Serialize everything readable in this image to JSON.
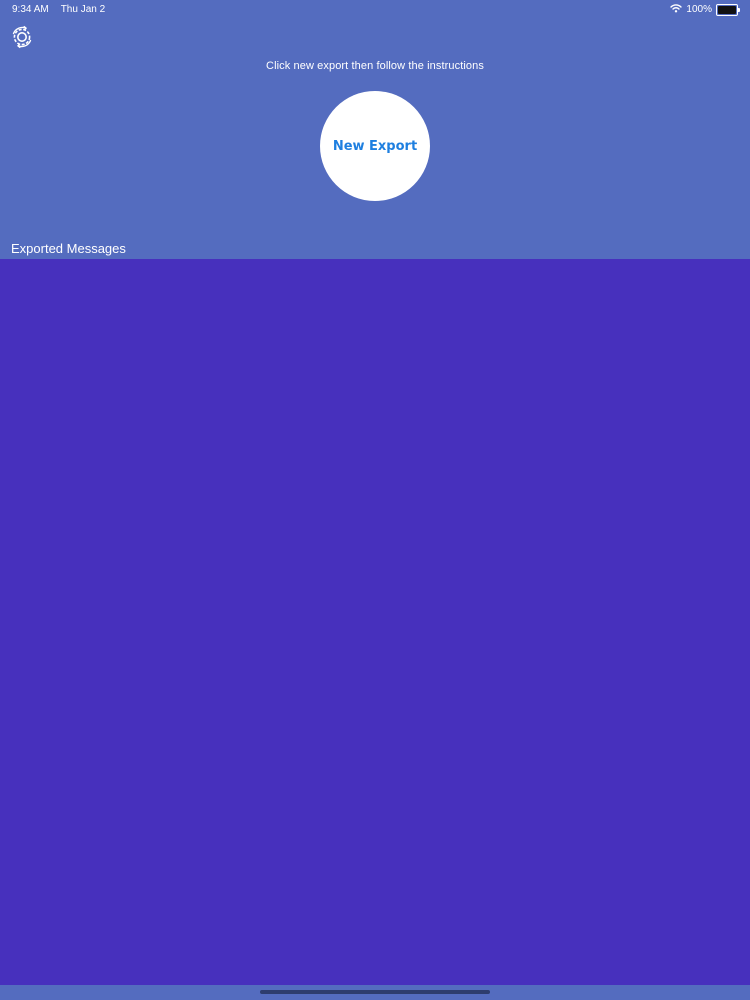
{
  "status_bar": {
    "time": "9:34 AM",
    "date": "Thu Jan 2",
    "battery_percent": "100%",
    "battery_level": 1.0,
    "wifi_icon": "wifi-icon",
    "battery_icon": "battery-icon"
  },
  "toolbar": {
    "settings_icon": "gear-icon"
  },
  "header": {
    "instructions": "Click new export then follow the instructions",
    "new_export_label": "New Export"
  },
  "messages": {
    "section_title": "Exported Messages",
    "items": []
  },
  "colors": {
    "header_background": "#546cbf",
    "list_background": "#4730bd",
    "button_background": "#ffffff",
    "button_text": "#1e7fe0",
    "home_indicator": "#2e3d6e"
  }
}
